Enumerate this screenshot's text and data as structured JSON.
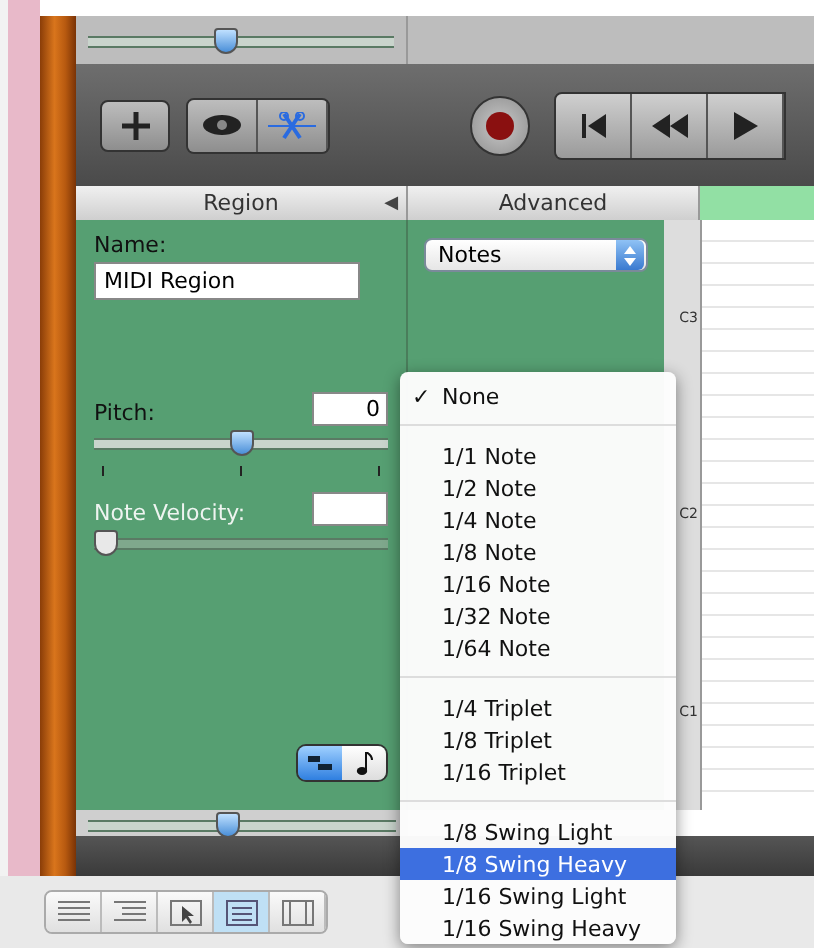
{
  "inspector": {
    "tabs": [
      {
        "label": "Region",
        "collapse_arrow": "◀"
      },
      {
        "label": "Advanced"
      }
    ]
  },
  "region": {
    "name_label": "Name:",
    "name_value": "MIDI Region",
    "pitch": {
      "label": "Pitch:",
      "value": "0",
      "level": 0.5,
      "disabled": false
    },
    "velocity": {
      "label": "Note Velocity:",
      "level": 0,
      "disabled": true
    },
    "view_toggle": [
      {
        "kind": "regions",
        "selected": true
      },
      {
        "kind": "notes",
        "selected": false
      }
    ]
  },
  "advanced": {
    "dropdown": "Notes"
  },
  "piano_labels": [
    "C3",
    "C2",
    "C1"
  ],
  "zoom_sliders": [
    {
      "level": 0.45
    },
    {
      "level": 0.45
    }
  ],
  "menu_check": "✓",
  "menu": [
    [
      {
        "label": "None",
        "checked": true,
        "selected": false
      }
    ],
    [
      {
        "label": "1/1 Note",
        "checked": false,
        "selected": false
      },
      {
        "label": "1/2 Note",
        "checked": false,
        "selected": false
      },
      {
        "label": "1/4 Note",
        "checked": false,
        "selected": false
      },
      {
        "label": "1/8 Note",
        "checked": false,
        "selected": false
      },
      {
        "label": "1/16 Note",
        "checked": false,
        "selected": false
      },
      {
        "label": "1/32 Note",
        "checked": false,
        "selected": false
      },
      {
        "label": "1/64 Note",
        "checked": false,
        "selected": false
      }
    ],
    [
      {
        "label": "1/4 Triplet",
        "checked": false,
        "selected": false
      },
      {
        "label": "1/8 Triplet",
        "checked": false,
        "selected": false
      },
      {
        "label": "1/16 Triplet",
        "checked": false,
        "selected": false
      }
    ],
    [
      {
        "label": "1/8 Swing Light",
        "checked": false,
        "selected": false
      },
      {
        "label": "1/8 Swing Heavy",
        "checked": false,
        "selected": true
      },
      {
        "label": "1/16 Swing Light",
        "checked": false,
        "selected": false
      },
      {
        "label": "1/16 Swing Heavy",
        "checked": false,
        "selected": false
      }
    ]
  ],
  "view_buttons": [
    {
      "kind": "list",
      "selected": false
    },
    {
      "kind": "outline",
      "selected": false
    },
    {
      "kind": "pointer",
      "selected": false
    },
    {
      "kind": "editor",
      "selected": true
    },
    {
      "kind": "media",
      "selected": false
    }
  ]
}
